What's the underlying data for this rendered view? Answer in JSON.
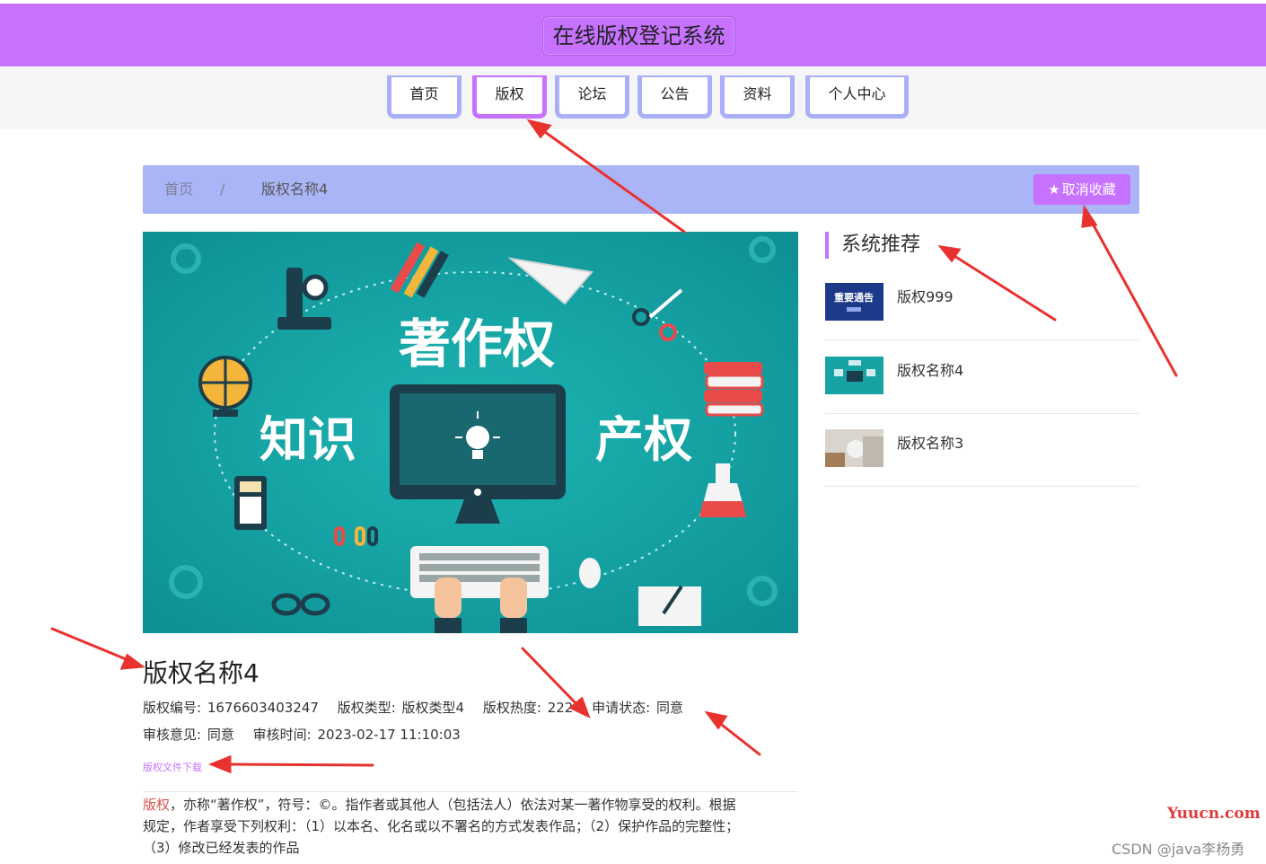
{
  "header": {
    "title": "在线版权登记系统"
  },
  "nav": {
    "items": [
      {
        "label": "首页"
      },
      {
        "label": "版权"
      },
      {
        "label": "论坛"
      },
      {
        "label": "公告"
      },
      {
        "label": "资料"
      },
      {
        "label": "个人中心"
      }
    ],
    "active_index": 1
  },
  "breadcrumb": {
    "home": "首页",
    "separator": "/",
    "current": "版权名称4",
    "favorite_button": "取消收藏"
  },
  "hero": {
    "texts": {
      "main": "著作权",
      "left": "知识",
      "right": "产权"
    }
  },
  "detail": {
    "title": "版权名称4",
    "fields": {
      "number_label": "版权编号:",
      "number_value": "1676603403247",
      "type_label": "版权类型:",
      "type_value": "版权类型4",
      "heat_label": "版权热度:",
      "heat_value": "222",
      "status_label": "申请状态:",
      "status_value": "同意",
      "opinion_label": "审核意见:",
      "opinion_value": "同意",
      "time_label": "审核时间:",
      "time_value": "2023-02-17 11:10:03"
    },
    "download_link": "版权文件下载",
    "description": {
      "keyword": "版权",
      "text_line1": "，亦称“著作权”，符号：©。指作者或其他人（包括法人）依法对某一著作物享受的权利。根据",
      "text_line2": "规定，作者享受下列权利：（1）以本名、化名或以不署名的方式发表作品；（2）保护作品的完整性；",
      "text_line3": "（3）修改已经发表的作品"
    }
  },
  "sidebar": {
    "title": "系统推荐",
    "items": [
      {
        "label": "版权999",
        "thumb_text": "重要通告"
      },
      {
        "label": "版权名称4"
      },
      {
        "label": "版权名称3"
      }
    ]
  },
  "watermarks": {
    "yuucn": "Yuucn.com",
    "csdn": "CSDN @java李杨勇"
  },
  "colors": {
    "header": "#c771ff",
    "nav_border": "#aab0f7",
    "breadcrumb_bg": "#aab5f7",
    "accent": "#c771ff",
    "hero_bg": "#17a2a4",
    "arrow": "#e8322f"
  }
}
